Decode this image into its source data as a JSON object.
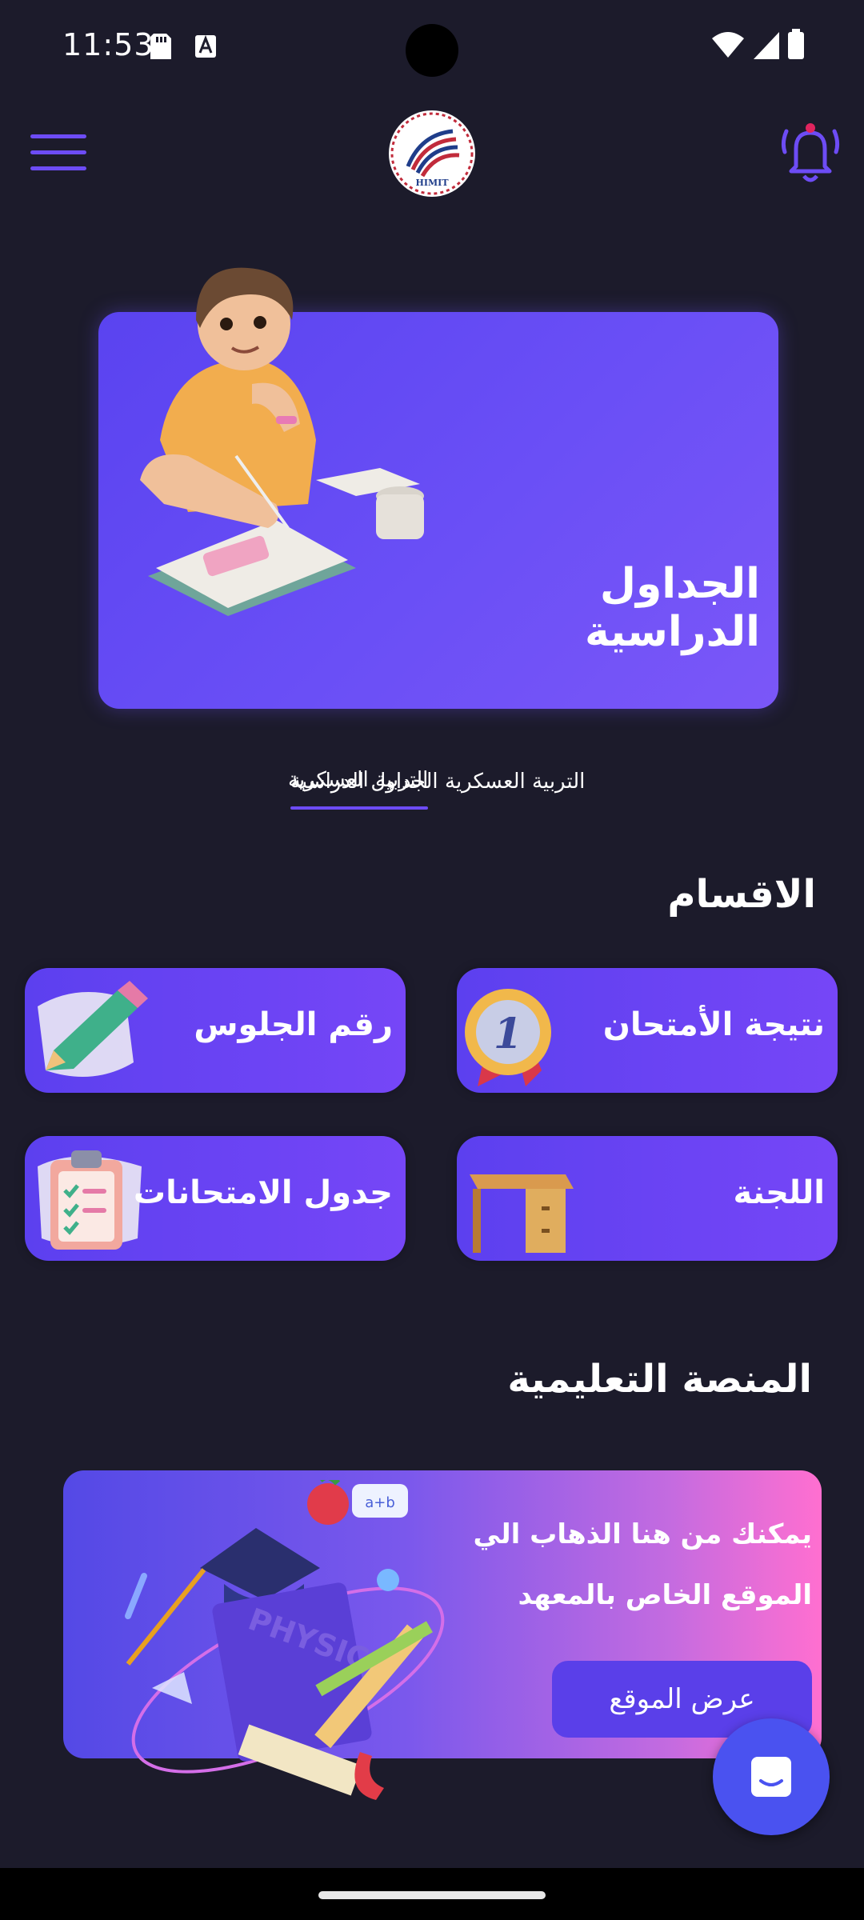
{
  "status_bar": {
    "time": "11:53"
  },
  "header": {
    "logo_text": "HIMIT"
  },
  "hero": {
    "title": "الجداول الدراسية"
  },
  "tabs": [
    {
      "label": "الجداول الدراسية",
      "selected": true
    },
    {
      "label": "التربية العسكرية",
      "selected": false
    }
  ],
  "sections": {
    "title": "الاقسام",
    "cards": [
      {
        "label": "نتيجة الأمتحان",
        "icon": "medal-icon"
      },
      {
        "label": "رقم الجلوس",
        "icon": "pencil-icon"
      },
      {
        "label": "اللجنة",
        "icon": "desk-icon"
      },
      {
        "label": "جدول الامتحانات",
        "icon": "clipboard-icon"
      }
    ]
  },
  "platform": {
    "title": "المنصة التعليمية",
    "text": "يمكنك من هنا الذهاب الي الموقع الخاص بالمعهد",
    "button_label": "عرض الموقع"
  },
  "colors": {
    "accent": "#6d4cf5",
    "background": "#1c1b2b",
    "card_start": "#5c40ef",
    "card_end": "#7646f7"
  }
}
